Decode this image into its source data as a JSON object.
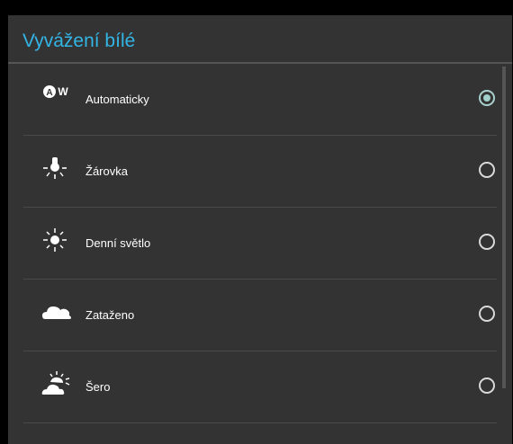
{
  "dialog": {
    "title": "Vyvážení bílé",
    "accent_color": "#33b5e5"
  },
  "options": [
    {
      "label": "Automaticky",
      "icon": "auto-wb-icon",
      "selected": true
    },
    {
      "label": "Žárovka",
      "icon": "incandescent-bulb-icon",
      "selected": false
    },
    {
      "label": "Denní světlo",
      "icon": "daylight-sun-icon",
      "selected": false
    },
    {
      "label": "Zataženo",
      "icon": "cloudy-icon",
      "selected": false
    },
    {
      "label": "Šero",
      "icon": "twilight-icon",
      "selected": false
    }
  ]
}
